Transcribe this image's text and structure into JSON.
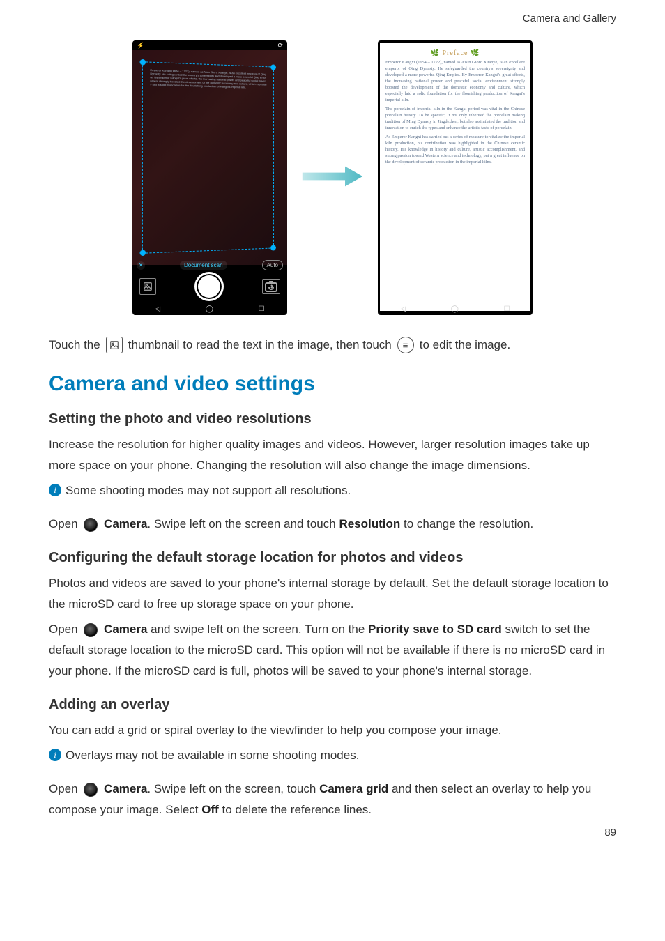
{
  "header": {
    "section": "Camera and Gallery"
  },
  "figure": {
    "left_phone": {
      "status_left": "⚡",
      "status_right": "⟳",
      "control_close": "✕",
      "control_label": "Document scan",
      "control_auto": "Auto"
    },
    "right_phone": {
      "preface_title": "🌿 Preface 🌿",
      "p1": "Emperor Kangxi (1654 – 1722), named as Aisin Gioro Xuanye, is an excellent emperor of Qing Dynasty. He safeguarded the country's sovereignty and developed a more powerful Qing Empire. By Emperor Kangxi's great efforts, the increasing national power and peaceful social environment strongly boosted the development of the domestic economy and culture, which especially laid a solid foundation for the flourishing production of Kangxi's imperial kiln.",
      "p2": "The porcelain of imperial kiln in the Kangxi period was vital in the Chinese porcelain history. To be specific, it not only inherited the porcelain making tradition of Ming Dynasty in Jingdezhen, but also assimilated the tradition and innovation to enrich the types and enhance the artistic taste of porcelain.",
      "p3": "As Emperor Kangxi has carried out a series of measure to vitalize the imperial kiln production, his contribution was highlighted in the Chinese ceramic history. His knowledge in history and culture, artistic accomplishment, and strong passion toward Western science and technology, put a great influence on the development of ceramic production in the imperial kilns."
    }
  },
  "line_after_figure": {
    "prefix": "Touch the ",
    "mid": " thumbnail to read the text in the image, then touch ",
    "suffix": " to edit the image."
  },
  "section_title": "Camera and video settings",
  "sub1": {
    "title": "Setting the photo and video resolutions",
    "para": "Increase the resolution for higher quality images and videos. However, larger resolution images take up more space on your phone. Changing the resolution will also change the image dimensions.",
    "note": "Some shooting modes may not support all resolutions.",
    "open_pre": "Open ",
    "camera": "Camera",
    "open_mid": ". Swipe left on the screen and touch ",
    "resolution": "Resolution",
    "open_post": " to change the resolution."
  },
  "sub2": {
    "title": "Configuring the default storage location for photos and videos",
    "para1": "Photos and videos are saved to your phone's internal storage by default. Set the default storage location to the microSD card to free up storage space on your phone.",
    "open_pre": "Open ",
    "camera": "Camera",
    "open_mid": " and swipe left on the screen. Turn on the ",
    "priority": "Priority save to SD card",
    "open_post": " switch to set the default storage location to the microSD card. This option will not be available if there is no microSD card in your phone. If the microSD card is full, photos will be saved to your phone's internal storage."
  },
  "sub3": {
    "title": "Adding an overlay",
    "para": "You can add a grid or spiral overlay to the viewfinder to help you compose your image.",
    "note": "Overlays may not be available in some shooting modes.",
    "open_pre": "Open ",
    "camera": "Camera",
    "open_mid": ". Swipe left on the screen, touch ",
    "grid": "Camera grid",
    "open_mid2": " and then select an overlay to help you compose your image. Select ",
    "off": "Off",
    "open_post": " to delete the reference lines."
  },
  "page_number": "89"
}
